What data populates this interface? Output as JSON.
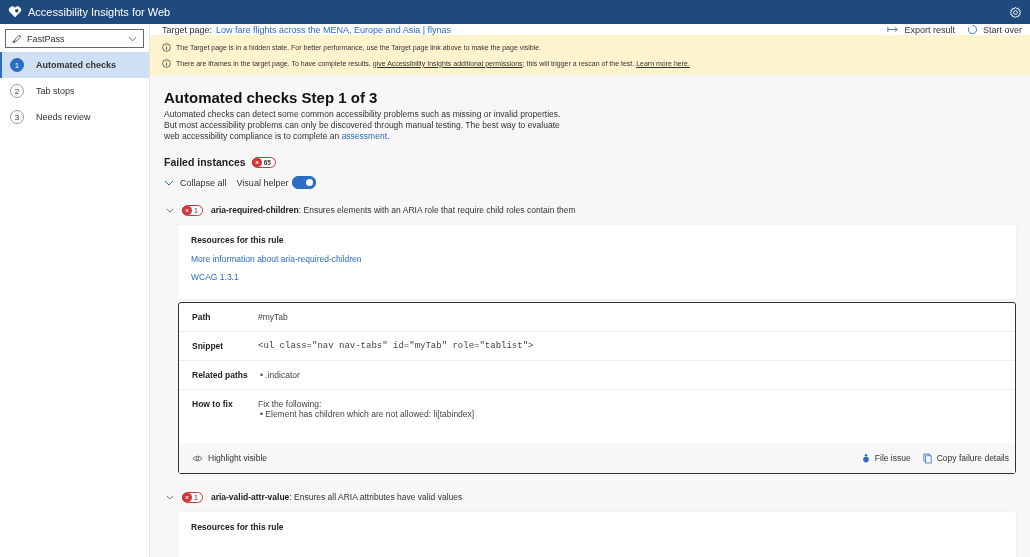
{
  "app": {
    "title": "Accessibility Insights for Web"
  },
  "sidebar": {
    "mode": "FastPass",
    "items": [
      {
        "number": "1",
        "label": "Automated checks",
        "selected": true
      },
      {
        "number": "2",
        "label": "Tab stops",
        "selected": false
      },
      {
        "number": "3",
        "label": "Needs review",
        "selected": false
      }
    ]
  },
  "target": {
    "label": "Target page:",
    "link": "Low fare flights across the MENA, Europe and Asia | flynas"
  },
  "actions": [
    "Export result",
    "Start over"
  ],
  "banners": [
    {
      "parts": [
        {
          "text": "The Target page is in a hidden state. For better performance, use the Target page link above to make the page visible.",
          "link": false
        }
      ]
    },
    {
      "parts": [
        {
          "text": "There are iframes in the target page. To have complete results, ",
          "link": false
        },
        {
          "text": "give Accessibility Insights additional permissions",
          "link": true
        },
        {
          "text": "; this will trigger a rescan of the test. ",
          "link": false
        },
        {
          "text": "Learn more here.",
          "link": true
        }
      ]
    }
  ],
  "heading": "Automated checks Step 1 of 3",
  "description": {
    "text": "Automated checks can detect some common accessibility problems such as missing or invalid properties. But most accessibility problems can only be discovered through manual testing. The best way to evaluate web accessibility compliance is to complete an",
    "link": "assessment",
    "end": "."
  },
  "failed": {
    "label": "Failed instances",
    "count": "65"
  },
  "collapse_all": "Collapse all",
  "visual_helper": {
    "label": "Visual helper",
    "on": true
  },
  "rules": [
    {
      "expanded": true,
      "count": "1",
      "name": "aria-required-children",
      "description": ": Ensures elements with an ARIA role that require child roles contain them",
      "resources": {
        "title": "Resources for this rule",
        "links": [
          "More information about aria-required-children",
          "WCAG 1.3.1"
        ]
      },
      "instances": [
        {
          "path_label": "Path",
          "path": "#myTab",
          "snippet_label": "Snippet",
          "snippet": "<ul class=\"nav nav-tabs\" id=\"myTab\" role=\"tablist\">",
          "related_label": "Related paths",
          "related": [
            ".indicator"
          ],
          "bullet": "•",
          "fix_label": "How to fix",
          "fix_intro": "Fix the following:",
          "fixes": [
            "Element has children which are not allowed: li[tabindex]"
          ],
          "highlight": "Highlight visible",
          "file_issue": "File issue",
          "copy": "Copy failure details"
        }
      ]
    },
    {
      "expanded": true,
      "count": "1",
      "name": "aria-valid-attr-value",
      "description": ": Ensures all ARIA attributes have valid values",
      "resources": {
        "title": "Resources for this rule"
      }
    }
  ]
}
